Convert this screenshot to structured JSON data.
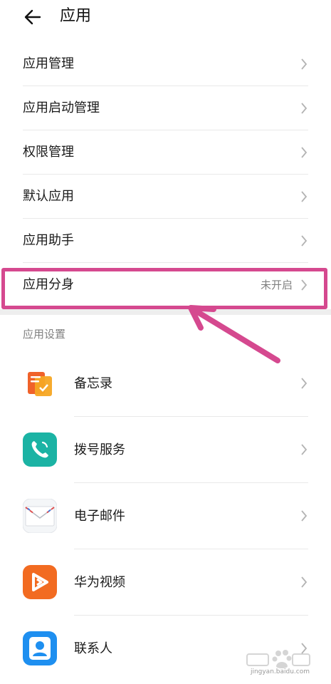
{
  "header": {
    "title": "应用"
  },
  "menu": [
    {
      "label": "应用管理",
      "value": ""
    },
    {
      "label": "应用启动管理",
      "value": ""
    },
    {
      "label": "权限管理",
      "value": ""
    },
    {
      "label": "默认应用",
      "value": ""
    },
    {
      "label": "应用助手",
      "value": ""
    },
    {
      "label": "应用分身",
      "value": "未开启"
    }
  ],
  "section": {
    "title": "应用设置"
  },
  "apps": [
    {
      "label": "备忘录",
      "icon": "notes-icon"
    },
    {
      "label": "拨号服务",
      "icon": "phone-icon"
    },
    {
      "label": "电子邮件",
      "icon": "email-icon"
    },
    {
      "label": "华为视频",
      "icon": "video-icon"
    },
    {
      "label": "联系人",
      "icon": "contacts-icon"
    }
  ],
  "watermark": {
    "url": "jingyan.baidu.com"
  },
  "colors": {
    "highlight": "#d5498f",
    "secondary_text": "#808080"
  }
}
